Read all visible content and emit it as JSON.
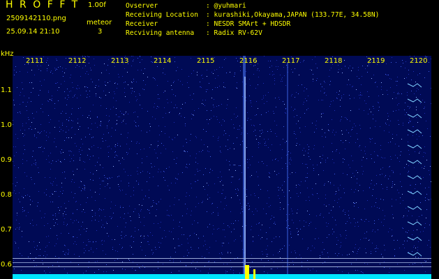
{
  "header": {
    "app_title": "HROFFT",
    "version": "1.00f",
    "filename": "2509142110.png",
    "datetime": "25.09.14 21:10",
    "meteor_label": "meteor",
    "meteor_count": "3"
  },
  "info": [
    {
      "key": "Ovserver",
      "value": ": @yuhmari"
    },
    {
      "key": "Receiving Location",
      "value": ": kurashiki,Okayama,JAPAN (133.77E, 34.58N)"
    },
    {
      "key": "Receiver",
      "value": ": NESDR SMArt + HDSDR"
    },
    {
      "key": "Recviving antenna",
      "value": ": Radix RV-62V"
    }
  ],
  "axes": {
    "unit": "kHz",
    "y_ticks": [
      "1.1",
      "1.0",
      "0.9",
      "0.8",
      "0.7",
      "0.6"
    ],
    "x_ticks": [
      "2111",
      "2112",
      "2113",
      "2114",
      "2115",
      "2116",
      "2117",
      "2118",
      "2119",
      "2120"
    ]
  },
  "colors": {
    "background": "#000000",
    "text": "#ffff00",
    "spectrum": "#000a55",
    "signal": "#00ffff"
  }
}
